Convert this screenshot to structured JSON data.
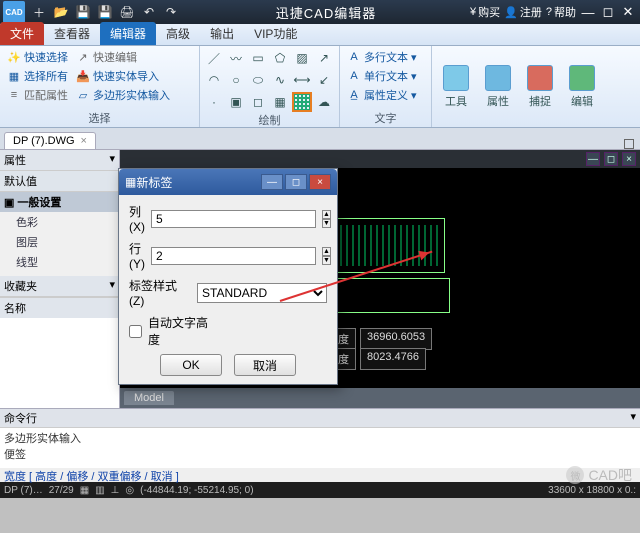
{
  "titlebar": {
    "app_title": "迅捷CAD编辑器",
    "buy": "购买",
    "register": "注册",
    "help": "帮助"
  },
  "tabs": {
    "file": "文件",
    "viewer": "查看器",
    "editor": "编辑器",
    "advanced": "高级",
    "output": "输出",
    "vip": "VIP功能"
  },
  "ribbon": {
    "sel_group": "选择",
    "quick_sel": "快速选择",
    "sel_all": "选择所有",
    "match_prop": "匹配属性",
    "quick_edit": "快速编辑",
    "quick_ext": "快速实体导入",
    "poly_input": "多边形实体输入",
    "draw_group": "绘制",
    "text_group": "文字",
    "mtext": "多行文本",
    "stext": "单行文本",
    "attdef": "属性定义",
    "tools": "工具",
    "props": "属性",
    "capture": "捕捉",
    "edit": "编辑"
  },
  "doctab": "DP (7).DWG",
  "leftpanel": {
    "props": "属性",
    "default": "默认值",
    "general": "一般设置",
    "color": "色彩",
    "layer": "图层",
    "linetype": "线型",
    "favorites": "收藏夹",
    "name": "名称"
  },
  "dialog": {
    "title": "新标签",
    "cols": "列(X)",
    "cols_v": "5",
    "rows": "行(Y)",
    "rows_v": "2",
    "style": "标签样式(Z)",
    "style_v": "STANDARD",
    "auto": "自动文字高度",
    "ok": "OK",
    "cancel": "取消"
  },
  "canvas": {
    "w_label": "宽度",
    "w_val": "36960.6053",
    "h_label": "高度",
    "h_val": "8023.4766",
    "model": "Model"
  },
  "cmd": {
    "head": "命令行",
    "l1": "多边形实体输入",
    "l2": "便签",
    "opts": "宽度 [ 高度 / 偏移 / 双重偏移 / 取消 ]"
  },
  "status": {
    "file": "DP (7)…",
    "prog": "27/29",
    "coords": "(-44844.19; -55214.95; 0)",
    "dims": "33600 x 18800 x 0.:"
  },
  "watermark": "CAD吧"
}
